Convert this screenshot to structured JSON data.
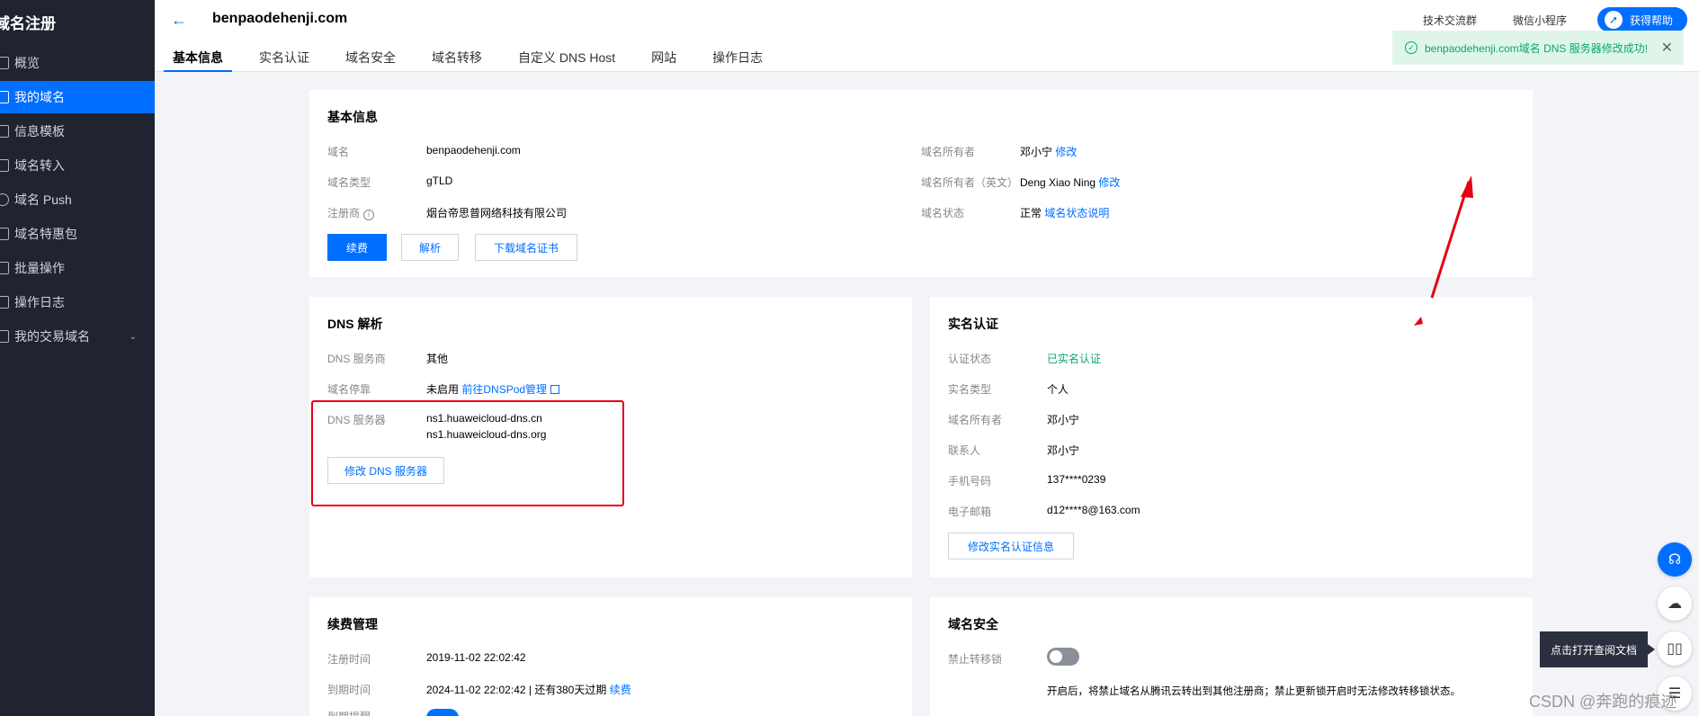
{
  "sidebar": {
    "brand": "域名注册",
    "items": [
      {
        "label": "概览"
      },
      {
        "label": "我的域名"
      },
      {
        "label": "信息模板"
      },
      {
        "label": "域名转入"
      },
      {
        "label": "域名 Push"
      },
      {
        "label": "域名特惠包"
      },
      {
        "label": "批量操作"
      },
      {
        "label": "操作日志"
      },
      {
        "label": "我的交易域名"
      }
    ]
  },
  "header": {
    "domain": "benpaodehenji.com",
    "tabs": [
      "基本信息",
      "实名认证",
      "域名安全",
      "域名转移",
      "自定义 DNS Host",
      "网站",
      "操作日志"
    ],
    "links": [
      "技术交流群",
      "微信小程序"
    ],
    "help": "获得帮助"
  },
  "toast": {
    "message": "benpaodehenji.com域名 DNS 服务器修改成功!",
    "close": "✕"
  },
  "basic": {
    "title": "基本信息",
    "domain_label": "域名",
    "domain_value": "benpaodehenji.com",
    "type_label": "域名类型",
    "type_value": "gTLD",
    "registrar_label": "注册商",
    "registrar_value": "烟台帝思普网络科技有限公司",
    "owner_label": "域名所有者",
    "owner_value": "邓小宁",
    "owner_edit": "修改",
    "owner_en_label": "域名所有者（英文）",
    "owner_en_value": "Deng Xiao Ning",
    "owner_en_edit": "修改",
    "status_label": "域名状态",
    "status_value": "正常",
    "status_link": "域名状态说明",
    "renew_btn": "续费",
    "resolve_btn": "解析",
    "cert_btn": "下载域名证书"
  },
  "dns": {
    "title": "DNS 解析",
    "provider_label": "DNS 服务商",
    "provider_value": "其他",
    "park_label": "域名停靠",
    "park_value": "未启用",
    "park_link": "前往DNSPod管理",
    "servers_label": "DNS 服务器",
    "server1": "ns1.huaweicloud-dns.cn",
    "server2": "ns1.huaweicloud-dns.org",
    "edit_btn": "修改 DNS 服务器"
  },
  "realname": {
    "title": "实名认证",
    "status_label": "认证状态",
    "status_value": "已实名认证",
    "type_label": "实名类型",
    "type_value": "个人",
    "owner_label": "域名所有者",
    "owner_value": "邓小宁",
    "contact_label": "联系人",
    "contact_value": "邓小宁",
    "phone_label": "手机号码",
    "phone_value": "137****0239",
    "email_label": "电子邮箱",
    "email_value": "d12****8@163.com",
    "edit_btn": "修改实名认证信息"
  },
  "renewal": {
    "title": "续费管理",
    "reg_label": "注册时间",
    "reg_value": "2019-11-02 22:02:42",
    "exp_label": "到期时间",
    "exp_value": "2024-11-02 22:02:42 | 还有380天过期",
    "exp_link": "续费",
    "auto_label": "到期提醒"
  },
  "security": {
    "title": "域名安全",
    "lock_label": "禁止转移锁",
    "lock_desc": "开启后，将禁止域名从腾讯云转出到其他注册商；禁止更新锁开启时无法修改转移锁状态。"
  },
  "float": {
    "tooltip": "点击打开查阅文档"
  },
  "watermark": "CSDN @奔跑的痕迹",
  "colors": {
    "primary": "#006eff",
    "sidebar_bg": "#1f2430",
    "success": "#0aa86a",
    "annotation": "#e60012"
  }
}
